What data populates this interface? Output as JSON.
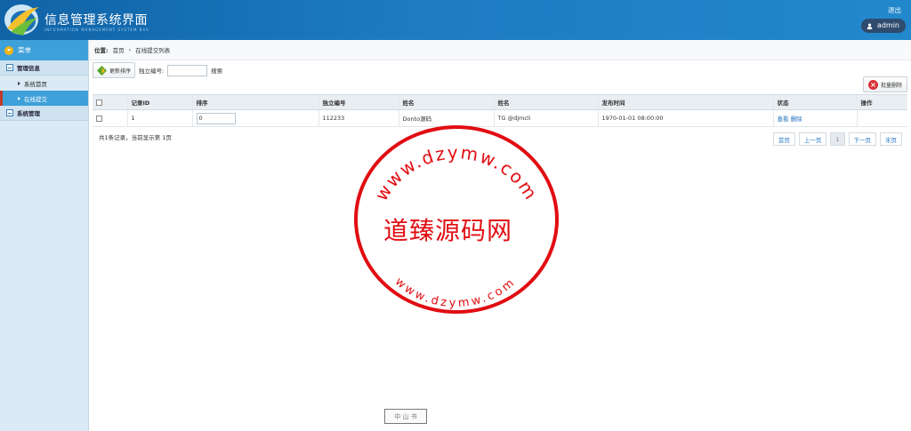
{
  "header": {
    "title": "信息管理系统界面",
    "subtitle": "INFORMATION MANAGEMENT SYSTEM BAS",
    "logout": "退出",
    "user": "admin"
  },
  "sidebar": {
    "menu_label": "菜单",
    "groups": [
      {
        "label": "管理信息",
        "items": [
          {
            "label": "系统首页"
          },
          {
            "label": "在线提交"
          }
        ]
      },
      {
        "label": "系统管理"
      }
    ]
  },
  "breadcrumb": {
    "prefix": "位置:",
    "home": "首页",
    "current": "在线提交列表"
  },
  "toolbar": {
    "refresh_label": "更新排序",
    "id_label": "独立编号:",
    "search_label": "搜索",
    "batch_delete_label": "批量删除"
  },
  "table": {
    "headers": [
      "记录ID",
      "排序",
      "独立编号",
      "姓名",
      "姓名",
      "发布时间",
      "状态",
      "操作"
    ],
    "rows": [
      {
        "id": "1",
        "sort": "0",
        "code": "112233",
        "name1": "Donto源码",
        "name2": "TG @djmcli",
        "time": "1970-01-01 08:00:00",
        "view": "查看",
        "delete": "删除"
      }
    ]
  },
  "summary": "共1条记录，当前显示第 1页",
  "pager": {
    "first": "首页",
    "prev": "上一页",
    "current": "1",
    "next": "下一页",
    "last": "末页"
  },
  "watermark": {
    "center": "道臻源码网",
    "top_arc": "www.dzymw.com",
    "bottom_arc": "www.dzymw.com",
    "seal_text": "中 山 书"
  },
  "colors": {
    "header": "#1868ad",
    "accent": "#3da0d9",
    "stamp": "#e10d12"
  }
}
